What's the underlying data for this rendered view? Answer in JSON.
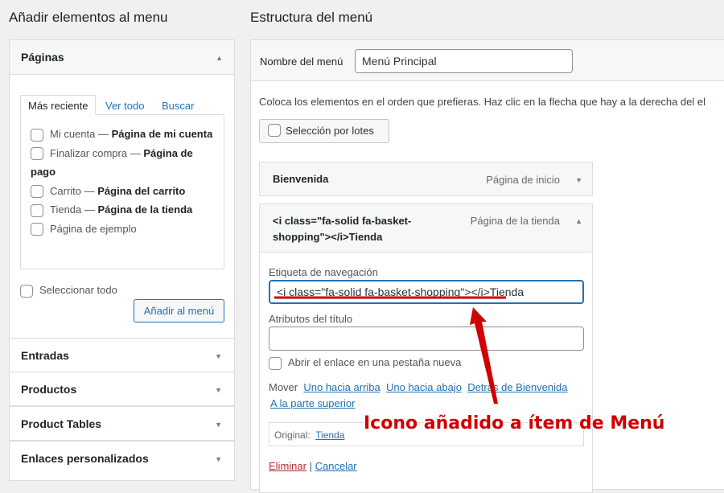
{
  "left": {
    "title": "Añadir elementos al menu",
    "pages_box": {
      "title": "Páginas",
      "tabs": [
        "Más reciente",
        "Ver todo",
        "Buscar"
      ],
      "items": [
        {
          "text": "Mi cuenta — ",
          "bold": "Página de mi cuenta"
        },
        {
          "text": "Finalizar compra — ",
          "bold": "Página de pago"
        },
        {
          "text": "Carrito — ",
          "bold": "Página del carrito"
        },
        {
          "text": "Tienda — ",
          "bold": "Página de la tienda"
        },
        {
          "text": "Página de ejemplo",
          "bold": ""
        }
      ],
      "select_all": "Seleccionar todo",
      "add_button": "Añadir al menú"
    },
    "sections": [
      "Entradas",
      "Productos",
      "Product Tables",
      "Enlaces personalizados"
    ]
  },
  "right": {
    "title": "Estructura del menú",
    "menu_name_label": "Nombre del menú",
    "menu_name_value": "Menú Principal",
    "instructions": "Coloca los elementos en el orden que prefieras. Haz clic en la flecha que hay a la derecha del el",
    "bulk_select": "Selección por lotes",
    "items": [
      {
        "title": "Bienvenida",
        "type": "Página de inicio"
      },
      {
        "title": "<i class=\"fa-solid fa-basket-shopping\"></i>Tienda",
        "type": "Página de la tienda"
      }
    ],
    "edit": {
      "nav_label": "Etiqueta de navegación",
      "nav_value": "<i class=\"fa-solid fa-basket-shopping\"></i>Tienda",
      "title_attr_label": "Atributos del título",
      "title_attr_value": "",
      "new_tab": "Abrir el enlace en una pestaña nueva",
      "move_label": "Mover",
      "move_links": [
        "Uno hacia arriba",
        "Uno hacia abajo",
        "Detrás de Bienvenida",
        "A la parte superior"
      ],
      "original_label": "Original:",
      "original_link": "Tienda",
      "delete": "Eliminar",
      "separator": "|",
      "cancel": "Cancelar"
    }
  },
  "annotation": {
    "text": "Icono añadido a ítem de Menú",
    "color": "#d10000"
  }
}
